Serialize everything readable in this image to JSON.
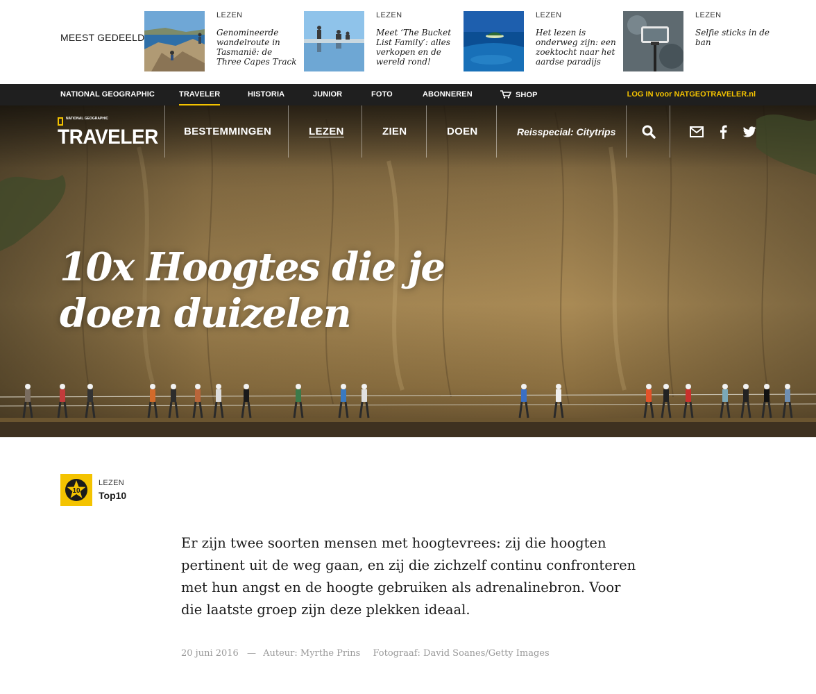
{
  "shared": {
    "title": "MEEST GEDEELD",
    "items": [
      {
        "category": "LEZEN",
        "text": "Genomineerde wandelroute in Tasmanië: de Three Capes Track"
      },
      {
        "category": "LEZEN",
        "text": "Meet ‘The Bucket List Family’: alles verkopen en de wereld rond!"
      },
      {
        "category": "LEZEN",
        "text": "Het lezen is onderweg zijn: een zoektocht naar het aardse paradijs"
      },
      {
        "category": "LEZEN",
        "text": "Selfie sticks in de ban"
      }
    ]
  },
  "natgeo_bar": {
    "items": [
      "NATIONAL GEOGRAPHIC",
      "TRAVELER",
      "HISTORIA",
      "JUNIOR",
      "FOTO",
      "ABONNEREN",
      "SHOP"
    ],
    "active": "TRAVELER",
    "login": "LOG IN voor NATGEOTRAVELER.nl"
  },
  "logo": {
    "small": "NATIONAL GEOGRAPHIC",
    "main": "TRAVELER"
  },
  "main_nav": {
    "items": [
      "BESTEMMINGEN",
      "LEZEN",
      "ZIEN",
      "DOEN"
    ],
    "active": "LEZEN",
    "special": "Reisspecial: Citytrips"
  },
  "hero": {
    "title": "10x Hoogtes die je doen duizelen"
  },
  "article": {
    "category": "LEZEN",
    "tag": "Top10",
    "badge": "10",
    "intro": "Er zijn twee soorten mensen met hoogtevrees: zij die hoogten pertinent uit de weg gaan, en zij die zichzelf continu confronteren met hun angst en de hoogte gebruiken als adrenalinebron. Voor die laatste groep zijn deze plekken ideaal.",
    "date": "20 juni 2016",
    "dash": "—",
    "author": "Auteur: Myrthe Prins",
    "photographer": "Fotograaf: David Soanes/Getty Images"
  },
  "colors": {
    "accent": "#f4c300",
    "bar": "#1f1f1f",
    "meta": "#9a9a9a"
  },
  "icons": [
    "cart-icon",
    "search-icon",
    "mail-icon",
    "facebook-icon",
    "twitter-icon",
    "top10-star-icon"
  ]
}
